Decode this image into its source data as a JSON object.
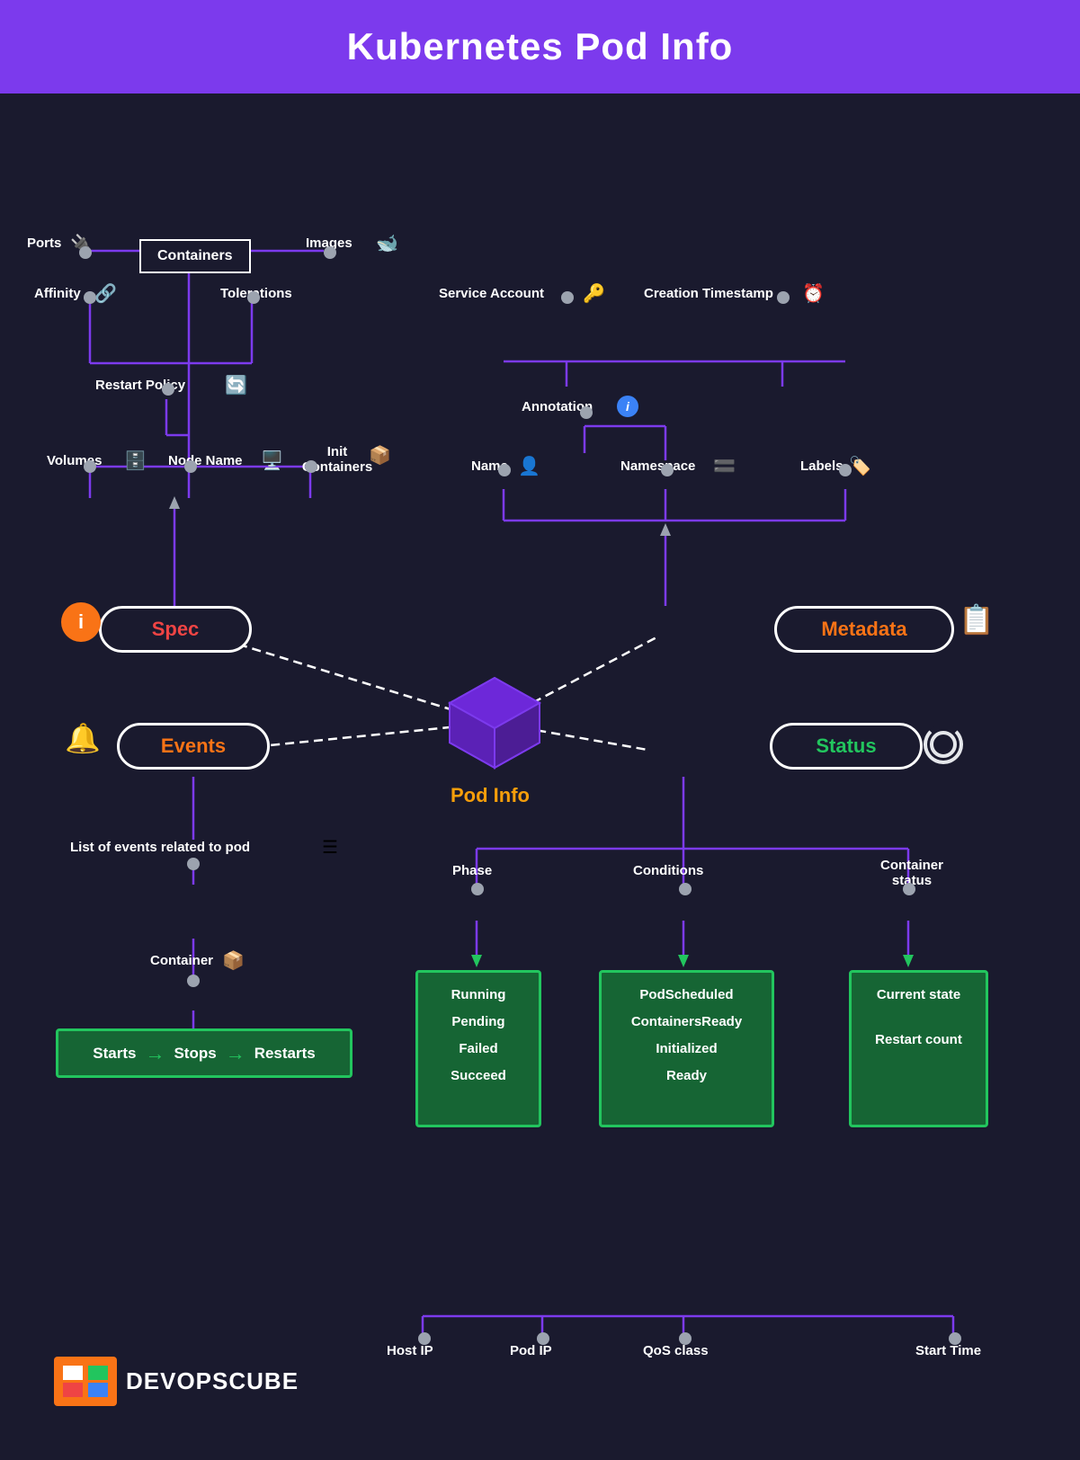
{
  "header": {
    "title": "Kubernetes Pod Info"
  },
  "nodes": {
    "containers": "Containers",
    "ports": "Ports",
    "images": "Images",
    "affinity": "Affinity",
    "tolerations": "Tolerations",
    "serviceAccount": "Service Account",
    "creationTimestamp": "Creation Timestamp",
    "annotation": "Annotation",
    "restartPolicy": "Restart Policy",
    "volumes": "Volumes",
    "nodeName": "Node Name",
    "initContainers": "Init Containers",
    "name": "Name",
    "namespace": "Namespace",
    "labels": "Labels",
    "spec": "Spec",
    "metadata": "Metadata",
    "events": "Events",
    "status": "Status",
    "podInfo": "Pod Info",
    "phase": "Phase",
    "conditions": "Conditions",
    "containerStatus": "Container status",
    "listEvents": "List of events related to pod",
    "container": "Container",
    "hostIp": "Host IP",
    "podIp": "Pod IP",
    "qosClass": "QoS class",
    "startTime": "Start Time"
  },
  "greenBoxes": {
    "startsStopsRestarts": {
      "starts": "Starts",
      "arrow1": "→",
      "stops": "Stops",
      "arrow2": "→",
      "restarts": "Restarts"
    },
    "phase": {
      "lines": [
        "Running",
        "Pending",
        "Failed",
        "Succeed"
      ]
    },
    "conditions": {
      "lines": [
        "PodScheduled",
        "ContainersReady",
        "Initialized",
        "Ready"
      ]
    },
    "containerStatus": {
      "lines": [
        "Current state",
        "",
        "Restart count"
      ]
    }
  },
  "logo": {
    "text": "DEVOPSCUBE"
  }
}
